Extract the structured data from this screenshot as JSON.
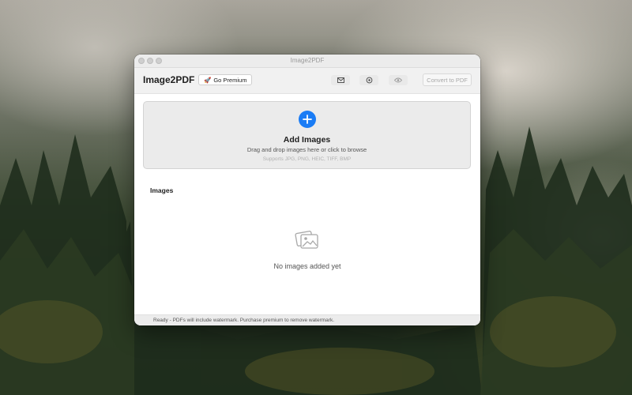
{
  "window": {
    "title": "Image2PDF"
  },
  "toolbar": {
    "app_name": "Image2PDF",
    "premium_label": "Go Premium",
    "premium_icon": "🚀",
    "convert_label": "Convert to PDF"
  },
  "dropzone": {
    "title": "Add Images",
    "subtitle": "Drag and drop images here or click to browse",
    "formats": "Supports JPG, PNG, HEIC, TIFF, BMP"
  },
  "images": {
    "section_label": "Images",
    "empty_text": "No images added yet"
  },
  "status": {
    "text": "Ready - PDFs will include watermark. Purchase premium to remove watermark."
  },
  "colors": {
    "accent": "#1a7cf5"
  }
}
